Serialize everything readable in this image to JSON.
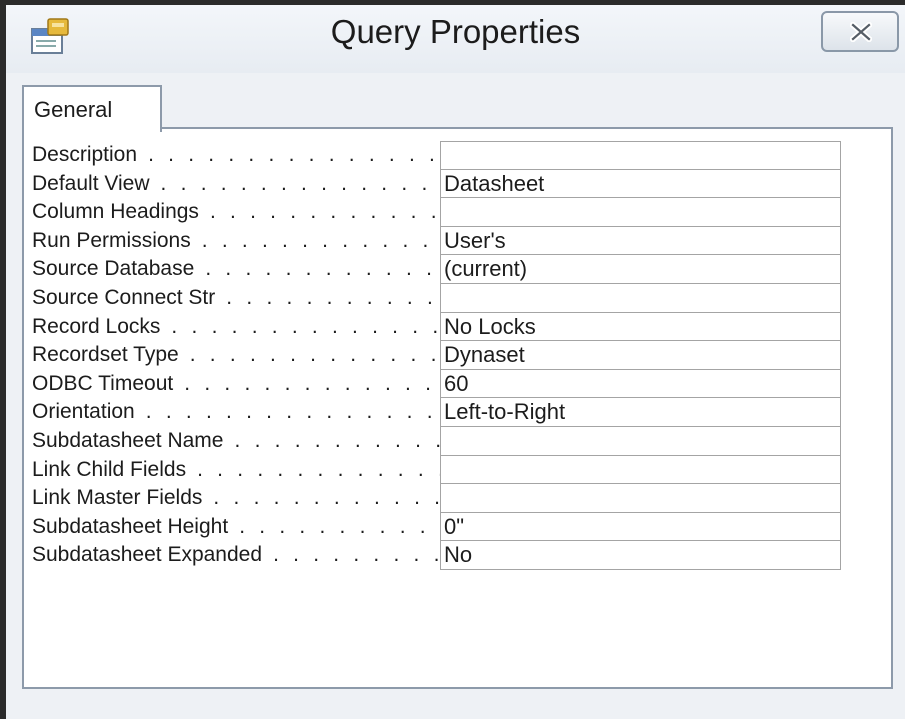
{
  "window": {
    "title": "Query Properties"
  },
  "tabs": [
    {
      "label": "General"
    }
  ],
  "properties": [
    {
      "label": "Description",
      "value": ""
    },
    {
      "label": "Default View",
      "value": "Datasheet"
    },
    {
      "label": "Column Headings",
      "value": ""
    },
    {
      "label": "Run Permissions",
      "value": "User's"
    },
    {
      "label": "Source Database",
      "value": "(current)"
    },
    {
      "label": "Source Connect Str",
      "value": ""
    },
    {
      "label": "Record Locks",
      "value": "No Locks"
    },
    {
      "label": "Recordset Type",
      "value": "Dynaset"
    },
    {
      "label": "ODBC Timeout",
      "value": "60"
    },
    {
      "label": "Orientation",
      "value": "Left-to-Right"
    },
    {
      "label": "Subdatasheet Name",
      "value": ""
    },
    {
      "label": "Link Child Fields",
      "value": ""
    },
    {
      "label": "Link Master Fields",
      "value": ""
    },
    {
      "label": "Subdatasheet Height",
      "value": "0\""
    },
    {
      "label": "Subdatasheet Expanded",
      "value": "No"
    }
  ],
  "icons": {
    "app": "property-sheet-icon",
    "close": "close-icon"
  }
}
